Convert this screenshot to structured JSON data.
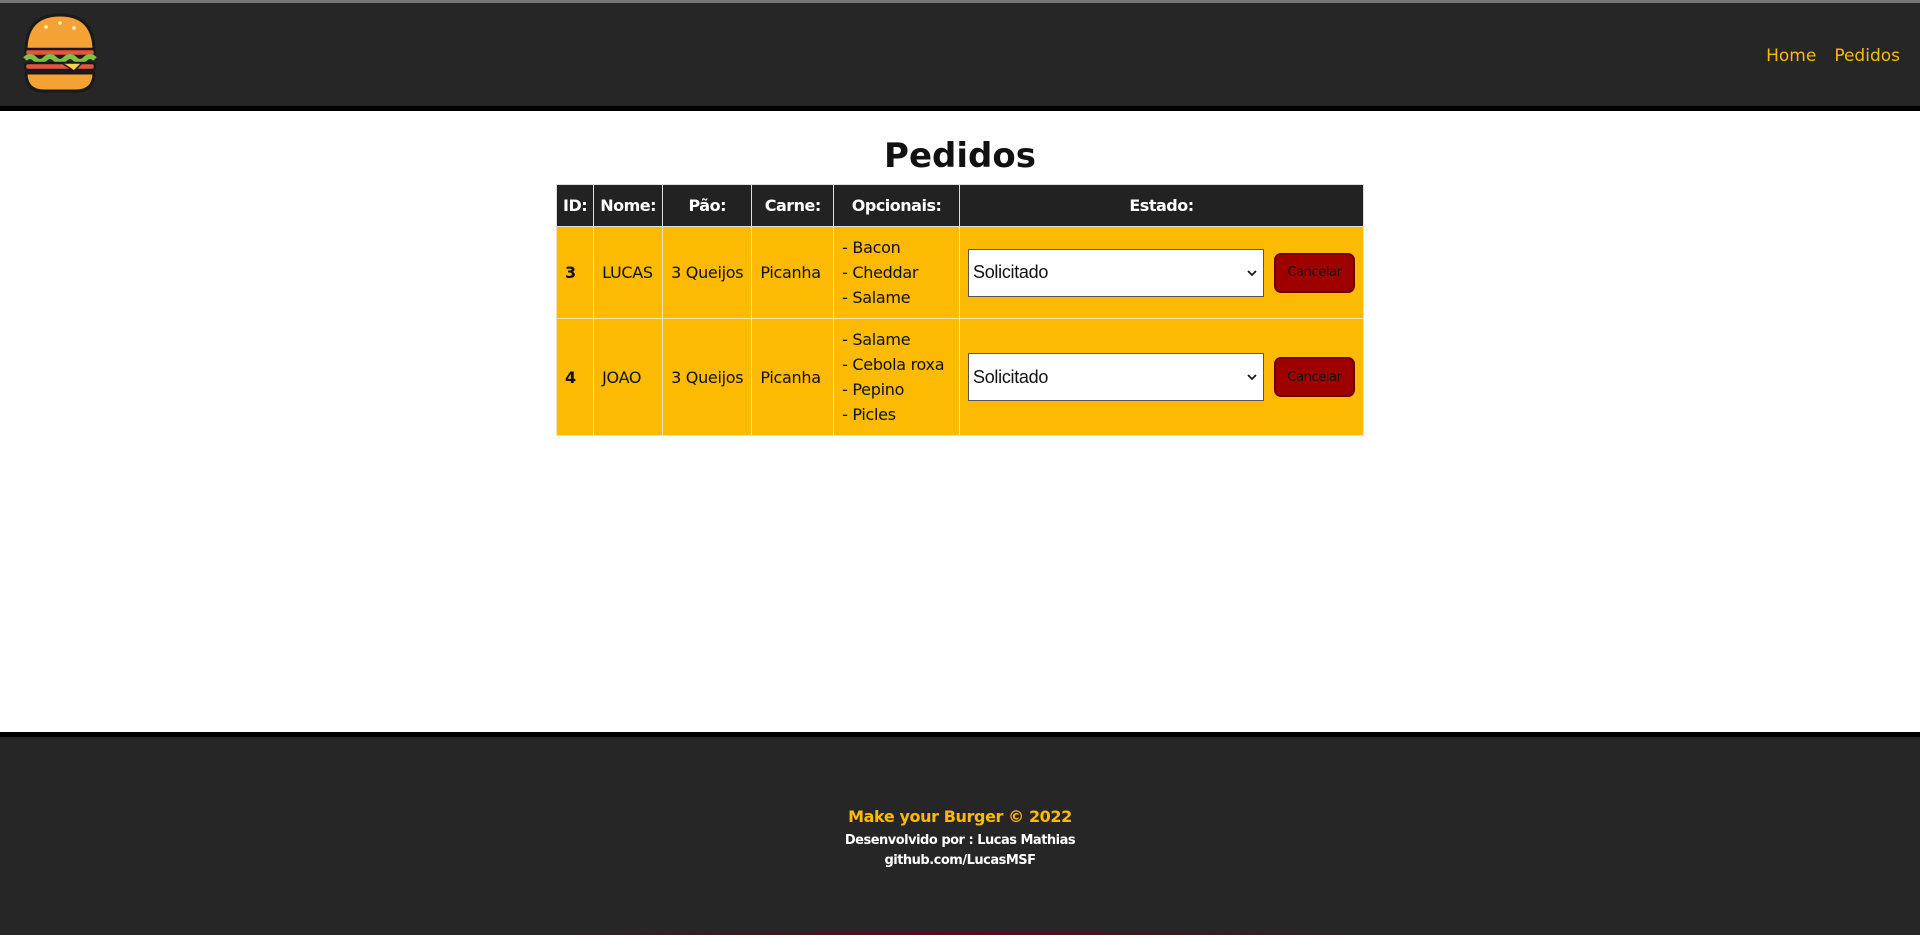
{
  "header": {
    "logo_name": "burger-logo",
    "nav": [
      {
        "label": "Home"
      },
      {
        "label": "Pedidos"
      }
    ]
  },
  "main": {
    "title": "Pedidos",
    "table": {
      "headers": [
        "ID:",
        "Nome:",
        "Pão:",
        "Carne:",
        "Opcionais:",
        "Estado:"
      ],
      "rows": [
        {
          "id": "3",
          "nome": "LUCAS",
          "pao": "3 Queijos",
          "carne": "Picanha",
          "opcionais": [
            "- Bacon",
            "- Cheddar",
            "- Salame"
          ],
          "estado": "Solicitado",
          "cancel_label": "Cancelar"
        },
        {
          "id": "4",
          "nome": "JOAO",
          "pao": "3 Queijos",
          "carne": "Picanha",
          "opcionais": [
            "- Salame",
            "- Cebola roxa",
            "- Pepino",
            "- Picles"
          ],
          "estado": "Solicitado",
          "cancel_label": "Cancelar"
        }
      ]
    }
  },
  "footer": {
    "line1": "Make your Burger © 2022",
    "line2": "Desenvolvido por : Lucas Mathias",
    "line3": "github.com/LucasMSF"
  },
  "colors": {
    "accent": "#fcba03",
    "dark": "#262626",
    "cancel": "#9e0000"
  }
}
